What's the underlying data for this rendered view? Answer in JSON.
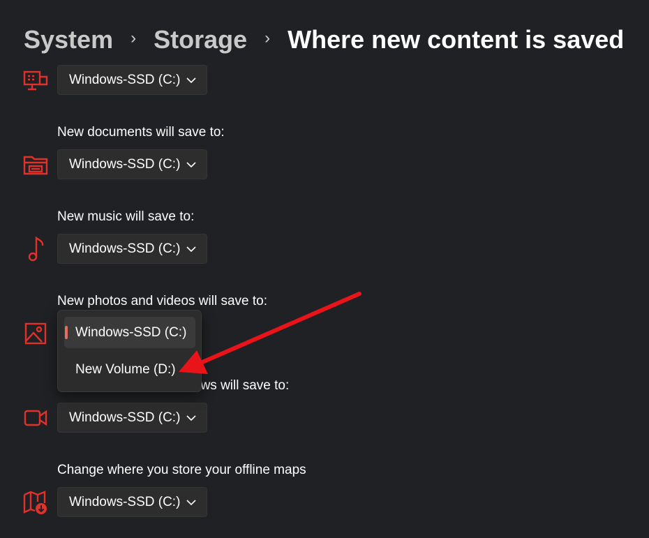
{
  "breadcrumb": {
    "system": "System",
    "storage": "Storage",
    "current": "Where new content is saved",
    "separator": "›"
  },
  "rows": [
    {
      "label": "",
      "value": "Windows-SSD (C:)",
      "icon": "monitor-icon"
    },
    {
      "label": "New documents will save to:",
      "value": "Windows-SSD (C:)",
      "icon": "folder-icon"
    },
    {
      "label": "New music will save to:",
      "value": "Windows-SSD (C:)",
      "icon": "music-note-icon"
    },
    {
      "label": "New photos and videos will save to:",
      "value": "",
      "icon": "image-icon"
    },
    {
      "label": "ws will save to:",
      "value": "Windows-SSD (C:)",
      "icon": "video-camera-icon"
    },
    {
      "label": "Change where you store your offline maps",
      "value": "Windows-SSD (C:)",
      "icon": "map-download-icon"
    }
  ],
  "dropdown_open": {
    "options": [
      "Windows-SSD (C:)",
      "New Volume (D:)"
    ],
    "selected_index": 0
  },
  "colors": {
    "background": "#202124",
    "icon_red": "#e0322b",
    "annotation_arrow": "#e8141a",
    "selection_indicator": "#e46e5f"
  }
}
